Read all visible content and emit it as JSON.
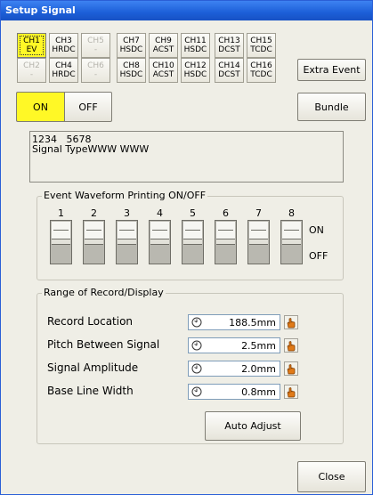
{
  "window": {
    "title": "Setup Signal"
  },
  "channels": [
    {
      "name": "CH1",
      "sub": "EV",
      "state": "selected"
    },
    {
      "name": "CH2",
      "sub": "-",
      "state": "disabled"
    },
    {
      "name": "CH3",
      "sub": "HRDC",
      "state": "normal"
    },
    {
      "name": "CH4",
      "sub": "HRDC",
      "state": "normal"
    },
    {
      "name": "CH5",
      "sub": "-",
      "state": "disabled"
    },
    {
      "name": "CH6",
      "sub": "-",
      "state": "disabled"
    },
    {
      "name": "CH7",
      "sub": "HSDC",
      "state": "normal"
    },
    {
      "name": "CH8",
      "sub": "HSDC",
      "state": "normal"
    },
    {
      "name": "CH9",
      "sub": "ACST",
      "state": "normal"
    },
    {
      "name": "CH10",
      "sub": "ACST",
      "state": "normal"
    },
    {
      "name": "CH11",
      "sub": "HSDC",
      "state": "normal"
    },
    {
      "name": "CH12",
      "sub": "HSDC",
      "state": "normal"
    },
    {
      "name": "CH13",
      "sub": "DCST",
      "state": "normal"
    },
    {
      "name": "CH14",
      "sub": "DCST",
      "state": "normal"
    },
    {
      "name": "CH15",
      "sub": "TCDC",
      "state": "normal"
    },
    {
      "name": "CH16",
      "sub": "TCDC",
      "state": "normal"
    }
  ],
  "buttons": {
    "extra_event": "Extra Event",
    "on": "ON",
    "off": "OFF",
    "bundle": "Bundle",
    "auto_adjust": "Auto Adjust",
    "close": "Close"
  },
  "signal_info": {
    "line1": "1234   5678",
    "line2": "Signal TypeWWW WWW"
  },
  "event_printing": {
    "legend": "Event Waveform Printing ON/OFF",
    "channels": [
      "1",
      "2",
      "3",
      "4",
      "5",
      "6",
      "7",
      "8"
    ],
    "on_label": "ON",
    "off_label": "OFF",
    "states": [
      "on",
      "on",
      "on",
      "on",
      "on",
      "on",
      "on",
      "on"
    ]
  },
  "range": {
    "legend": "Range of Record/Display",
    "fields": [
      {
        "label": "Record Location",
        "value": "188.5mm"
      },
      {
        "label": "Pitch Between Signal",
        "value": "2.5mm"
      },
      {
        "label": "Signal Amplitude",
        "value": "2.0mm"
      },
      {
        "label": "Base Line Width",
        "value": "0.8mm"
      }
    ]
  },
  "colors": {
    "selected": "#fff826",
    "titlebar": "#1c5fd8",
    "panel": "#efeee6"
  },
  "icons": {
    "field_prefix": "dial-icon",
    "field_action": "hand-pointer-icon"
  }
}
